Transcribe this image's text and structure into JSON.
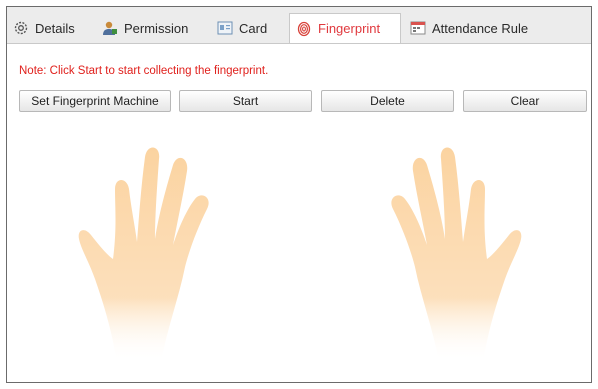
{
  "tabs": [
    {
      "label": "Details",
      "icon": "gear-icon"
    },
    {
      "label": "Permission",
      "icon": "user-icon"
    },
    {
      "label": "Card",
      "icon": "card-icon"
    },
    {
      "label": "Fingerprint",
      "icon": "fingerprint-icon",
      "active": true
    },
    {
      "label": "Attendance Rule",
      "icon": "calendar-icon"
    }
  ],
  "note": "Note: Click Start to start collecting the fingerprint.",
  "buttons": {
    "set_machine": "Set Fingerprint Machine",
    "start": "Start",
    "delete": "Delete",
    "clear": "Clear"
  },
  "colors": {
    "active_tab_text": "#e0393e",
    "note_text": "#e0201c",
    "hand_fill": "#fbd7a6"
  }
}
